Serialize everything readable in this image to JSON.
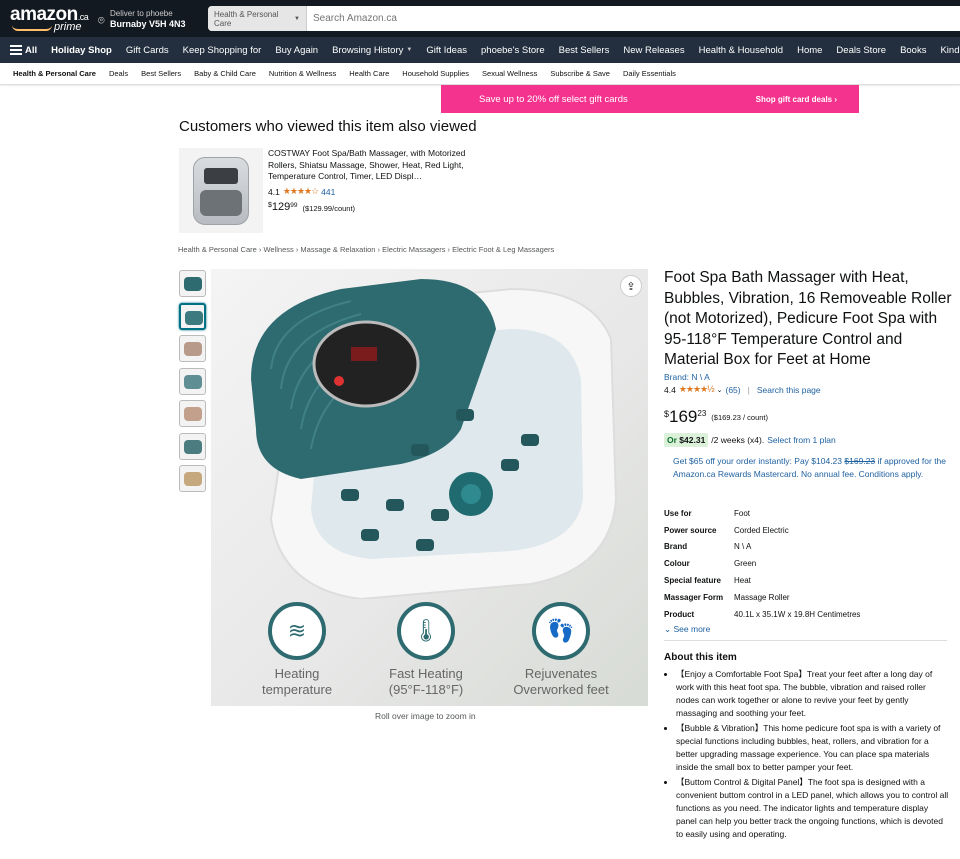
{
  "header": {
    "logo_text": "amazon",
    "logo_suffix": ".ca",
    "logo_prime": "prime",
    "deliver_line1": "Deliver to phoebe",
    "deliver_line2": "Burnaby V5H 4N3",
    "search_category": "Health & Personal Care",
    "search_placeholder": "Search Amazon.ca"
  },
  "nav": {
    "all": "All",
    "items": [
      "Holiday Shop",
      "Gift Cards",
      "Keep Shopping for",
      "Buy Again",
      "Browsing History",
      "Gift Ideas",
      "phoebe's Store",
      "Best Sellers",
      "New Releases",
      "Health & Household",
      "Home",
      "Deals Store",
      "Books",
      "Kindle B"
    ]
  },
  "subnav": {
    "items": [
      "Health & Personal Care",
      "Deals",
      "Best Sellers",
      "Baby & Child Care",
      "Nutrition & Wellness",
      "Health Care",
      "Household Supplies",
      "Sexual Wellness",
      "Subscribe & Save",
      "Daily Essentials"
    ]
  },
  "banner": {
    "message": "Save up to 20% off select gift cards",
    "link": "Shop gift card deals ›",
    "color": "#f4338f"
  },
  "also_viewed": {
    "title": "Customers who viewed this item also viewed",
    "product_title": "COSTWAY Foot Spa/Bath Massager, with Motorized Rollers, Shiatsu Massage, Shower, Heat, Red Light, Temperature Control, Timer, LED Displ…",
    "rating": "4.1",
    "stars": "★★★★☆",
    "reviews": "441",
    "price_symbol": "$",
    "price_whole": "129",
    "price_fraction": "99",
    "price_per": "($129.99/count)"
  },
  "breadcrumb": "Health & Personal Care › Wellness › Massage & Relaxation › Electric Massagers › Electric Foot & Leg Massagers",
  "image": {
    "share_icon": "share-icon",
    "features": [
      {
        "label_line1": "Heating",
        "label_line2": "temperature",
        "icon": "heat-waves-icon"
      },
      {
        "label_line1": "Fast Heating",
        "label_line2": "(95°F-118°F)",
        "icon": "thermometer-icon"
      },
      {
        "label_line1": "Rejuvenates",
        "label_line2": "Overworked feet",
        "icon": "feet-icon"
      }
    ],
    "zoom_note": "Roll over image to zoom in"
  },
  "product": {
    "title": "Foot Spa Bath Massager with Heat, Bubbles, Vibration, 16 Removeable Roller (not Motorized), Pedicure Foot Spa with 95-118°F Temperature Control and Material Box for Feet at Home",
    "brand_link": "Brand: N \\ A",
    "rating": "4.4",
    "stars": "★★★★½",
    "reviews": "(65)",
    "search_page": "Search this page",
    "price_symbol": "$",
    "price_whole": "169",
    "price_fraction": "23",
    "price_per": "($169.23 / count)",
    "installment_pre": "Or",
    "installment_amount": "$42.31",
    "installment_post": "/2 weeks (x4).",
    "installment_link": "Select from 1 plan",
    "promo_text_1": "Get $65 off your order instantly: Pay $104.23",
    "promo_strike": "$169.23",
    "promo_text_2": "if approved for the Amazon.ca Rewards Mastercard. No annual fee. Conditions apply.",
    "specs": [
      {
        "k": "Use for",
        "v": "Foot"
      },
      {
        "k": "Power source",
        "v": "Corded Electric"
      },
      {
        "k": "Brand",
        "v": "N \\ A"
      },
      {
        "k": "Colour",
        "v": "Green"
      },
      {
        "k": "Special feature",
        "v": "Heat"
      },
      {
        "k": "Massager Form",
        "v": "Massage Roller"
      },
      {
        "k": "Product",
        "v": "40.1L x 35.1W x 19.8H Centimetres"
      }
    ],
    "see_more": "See more",
    "about_title": "About this item",
    "about": [
      "【Enjoy a Comfortable Foot Spa】Treat your feet after a long day of work with this heat foot spa. The bubble, vibration and raised roller nodes can work together or alone to revive your feet by gently massaging and soothing your feet.",
      "【Bubble & Vibration】This home pedicure foot spa is with a variety of special functions including bubbles, heat, rollers, and vibration for a better upgrading massage experience. You can place spa materials inside the small box to better pamper your feet.",
      "【Buttom Control & Digital Panel】The foot spa is designed with a convenient buttom control in a LED panel, which allows you to control all functions as you need. The indicator lights and temperature display panel can help you better track the ongoing functions, which is devoted to easily using and operating."
    ]
  }
}
